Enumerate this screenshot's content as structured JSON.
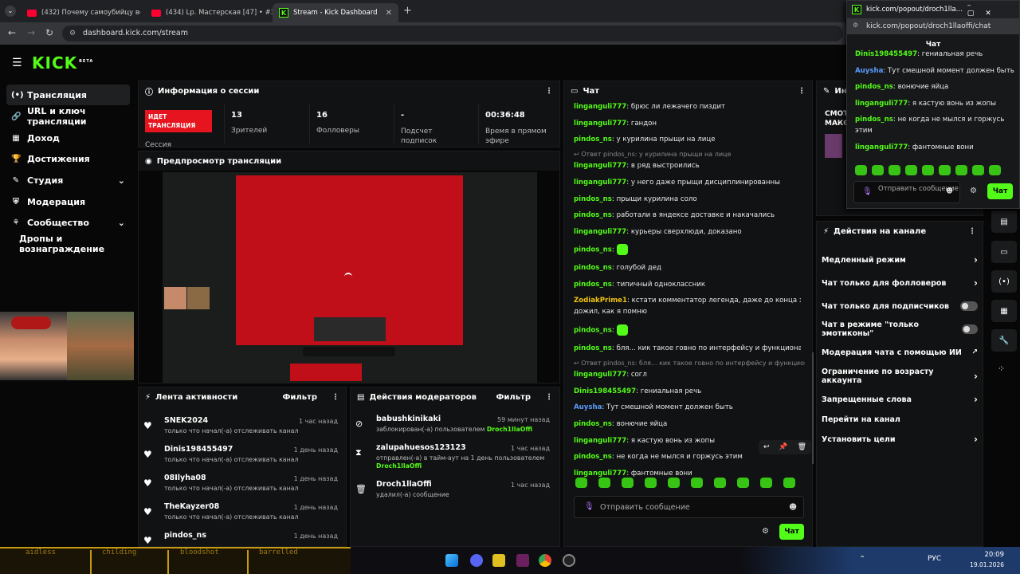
{
  "browser": {
    "tabs": [
      {
        "title": "(432) Почему самоубийцу все...",
        "icon": "youtube-icon"
      },
      {
        "title": "(434) Lp. Мастерская [47] • #3...",
        "icon": "youtube-icon"
      },
      {
        "title": "Stream - Kick Dashboard",
        "icon": "kick-icon"
      }
    ],
    "url": "dashboard.kick.com/stream"
  },
  "header": {
    "logo": "KICK",
    "logo_badge": "BETA"
  },
  "sidebar": {
    "items": [
      {
        "label": "Трансляция",
        "icon": "broadcast-icon"
      },
      {
        "label": "URL и ключ трансляции",
        "icon": "link-icon"
      },
      {
        "label": "Доход",
        "icon": "income-icon"
      },
      {
        "label": "Достижения",
        "icon": "trophy-icon"
      },
      {
        "label": "Студия",
        "icon": "studio-icon"
      },
      {
        "label": "Модерация",
        "icon": "shield-icon"
      },
      {
        "label": "Сообщество",
        "icon": "community-icon"
      },
      {
        "label": "Дропы и вознаграждение",
        "icon": ""
      }
    ]
  },
  "session": {
    "title": "Информация о сессии",
    "status": "ИДЕТ ТРАНСЛЯЦИЯ",
    "status_label": "Сессия",
    "stats": [
      {
        "value": "13",
        "label": "Зрителей"
      },
      {
        "value": "16",
        "label": "Фолловеры"
      },
      {
        "value": "-",
        "label": "Подсчет подписок"
      },
      {
        "value": "00:36:48",
        "label": "Время в прямом эфире"
      }
    ]
  },
  "preview": {
    "title": "Предпросмотр трансляции"
  },
  "activity": {
    "title": "Лента активности",
    "filter": "Фильтр",
    "items": [
      {
        "name": "SNEK2024",
        "time": "1 час назад",
        "text": "только что начал(-а) отслеживать канал"
      },
      {
        "name": "Dinis198455497",
        "time": "1 день назад",
        "text": "только что начал(-а) отслеживать канал"
      },
      {
        "name": "08Ilyha08",
        "time": "1 день назад",
        "text": "только что начал(-а) отслеживать канал"
      },
      {
        "name": "TheKayzer08",
        "time": "1 день назад",
        "text": "только что начал(-а) отслеживать канал"
      },
      {
        "name": "pindos_ns",
        "time": "1 день назад",
        "text": ""
      }
    ]
  },
  "modactions": {
    "title": "Действия модераторов",
    "filter": "Фильтр",
    "items": [
      {
        "name": "babushkinikaki",
        "time": "59 минут назад",
        "text": "заблокирован(-а) пользователем",
        "by": "Droch1llaOffi",
        "icon": "ban-icon"
      },
      {
        "name": "zalupahuesos123123",
        "time": "1 час назад",
        "text": "отправлен(-а) в тайм-аут на 1 день пользователем",
        "by": "Droch1llaOffi",
        "icon": "hourglass-icon"
      },
      {
        "name": "Droch1llaOffi",
        "time": "1 час назад",
        "text": "удалил(-а) сообщение",
        "by": "",
        "icon": "trash-icon"
      }
    ]
  },
  "chat": {
    "title": "Чат",
    "messages": [
      {
        "user": "linganguli777",
        "text": "брюс ли лежачего пиздит",
        "color": "#53fc18"
      },
      {
        "user": "linganguli777",
        "text": "гандон",
        "color": "#53fc18"
      },
      {
        "user": "pindos_ns",
        "text": "у курилина прыщи на лице",
        "color": "#53fc18"
      },
      {
        "reply": "↩ Ответ pindos_ns: у курилина прыщи на лице"
      },
      {
        "user": "linganguli777",
        "text": "в ряд выстроились",
        "color": "#53fc18"
      },
      {
        "user": "linganguli777",
        "text": "у него даже прыщи дисциплинированны",
        "color": "#53fc18"
      },
      {
        "user": "pindos_ns",
        "text": "прыщи курилина соло",
        "color": "#53fc18"
      },
      {
        "user": "pindos_ns",
        "text": "работали в яндексе доставке и накачались",
        "color": "#53fc18"
      },
      {
        "user": "linganguli777",
        "text": "курьеры сверхлюди, доказано",
        "color": "#53fc18"
      },
      {
        "user": "pindos_ns",
        "text": "",
        "emote": true,
        "color": "#53fc18"
      },
      {
        "user": "pindos_ns",
        "text": "голубой дед",
        "color": "#53fc18"
      },
      {
        "user": "pindos_ns",
        "text": "типичный одноклассник",
        "color": "#53fc18"
      },
      {
        "user": "ZodiakPrime1",
        "text": "кстати комментатор легенда, даже до конца зета",
        "color": "#f1c40f"
      },
      {
        "cont": "дожил, как я помню"
      },
      {
        "user": "pindos_ns",
        "text": "",
        "emote": true,
        "color": "#53fc18"
      },
      {
        "user": "pindos_ns",
        "text": "бля... кик такое говно по интерфейсу и функционалу",
        "color": "#53fc18"
      },
      {
        "reply": "↩ Ответ pindos_ns: бля... кик такое говно по интерфейсу и функциона..."
      },
      {
        "user": "linganguli777",
        "text": "согл",
        "color": "#53fc18"
      },
      {
        "user": "Dinis198455497",
        "text": "гениальная речь",
        "color": "#53fc18"
      },
      {
        "user": "Auysha",
        "text": "Тут смешной момент должен быть",
        "color": "#5b9dff"
      },
      {
        "user": "pindos_ns",
        "text": "вонючие яйца",
        "color": "#53fc18"
      },
      {
        "user": "linganguli777",
        "text": "я кастую вонь из жопы",
        "color": "#53fc18"
      },
      {
        "user": "pindos_ns",
        "text": "не когда не мылся и горжусь этим",
        "color": "#53fc18"
      },
      {
        "user": "linganguli777",
        "text": "фантомные вони",
        "color": "#53fc18"
      }
    ],
    "input_placeholder": "Отправить сообщение",
    "send_label": "Чат"
  },
  "info_panel": {
    "title": "Инф",
    "lines": [
      "СМОТ",
      "МАКС"
    ]
  },
  "channel_actions": {
    "title": "Действия на канале",
    "items": [
      {
        "label": "Медленный режим",
        "control": "chevron"
      },
      {
        "label": "Чат только для фолловеров",
        "control": "chevron"
      },
      {
        "label": "Чат только для подписчиков",
        "control": "toggle"
      },
      {
        "label": "Чат в режиме \"только эмотиконы\"",
        "control": "toggle"
      },
      {
        "label": "Модерация чата с помощью ИИ",
        "control": "external"
      },
      {
        "label": "Ограничение по возрасту аккаунта",
        "control": "chevron"
      },
      {
        "label": "Запрещенные слова",
        "control": "chevron"
      },
      {
        "label": "Перейти на канал",
        "control": "none"
      },
      {
        "label": "Установить цели",
        "control": "chevron"
      }
    ]
  },
  "popup": {
    "title_url": "kick.com/popout/droch1lla...",
    "url": "kick.com/popout/droch1llaoffi/chat",
    "chat_title": "Чат",
    "messages": [
      {
        "user": "Dinis198455497",
        "text": "гениальная речь",
        "color": "#53fc18"
      },
      {
        "user": "Auysha",
        "text": "Тут смешной момент должен быть",
        "color": "#5b9dff"
      },
      {
        "user": "pindos_ns",
        "text": "вонючие яйца",
        "color": "#53fc18"
      },
      {
        "user": "linganguli777",
        "text": "я кастую вонь из жопы",
        "color": "#53fc18"
      },
      {
        "user": "pindos_ns",
        "text": "не когда не мылся и горжусь",
        "color": "#53fc18"
      },
      {
        "cont": "этим"
      },
      {
        "user": "linganguli777",
        "text": "фантомные вони",
        "color": "#53fc18"
      }
    ],
    "input_placeholder": "Отправить сообщение",
    "send_label": "Чат"
  },
  "taskbar": {
    "ticker": [
      "aidless",
      "childing",
      "bloodshot",
      "barrelled"
    ],
    "lang": "РУС",
    "time": "20:09",
    "date": "19.01.2026"
  },
  "colors": {
    "accent": "#53fc18",
    "live": "#e5141e",
    "bg": "#070707",
    "panel": "#111213"
  }
}
